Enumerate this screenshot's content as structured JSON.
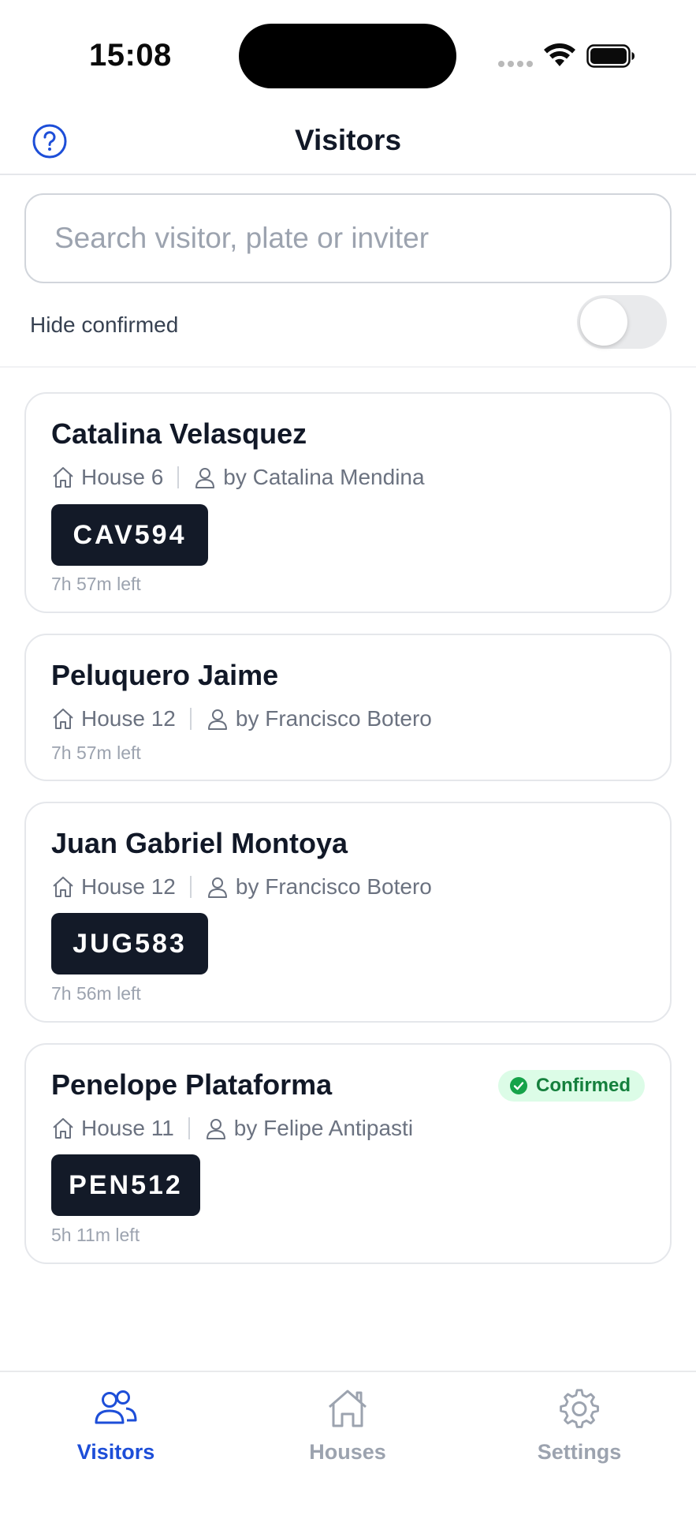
{
  "status_bar": {
    "time": "15:08"
  },
  "header": {
    "title": "Visitors"
  },
  "search": {
    "placeholder": "Search visitor, plate or inviter"
  },
  "filter": {
    "hide_confirmed_label": "Hide confirmed",
    "hide_confirmed_on": false
  },
  "visitors": [
    {
      "name": "Catalina Velasquez",
      "house": "House 6",
      "inviter": "by Catalina Mendina",
      "plate": "CAV594",
      "time_left": "7h 57m left"
    },
    {
      "name": "Peluquero Jaime",
      "house": "House 12",
      "inviter": "by Francisco Botero",
      "plate": "",
      "time_left": "7h 57m left"
    },
    {
      "name": "Juan Gabriel Montoya",
      "house": "House 12",
      "inviter": "by Francisco Botero",
      "plate": "JUG583",
      "time_left": "7h 56m left"
    },
    {
      "name": "Penelope Plataforma",
      "house": "House 11",
      "inviter": "by Felipe Antipasti",
      "plate": "PEN512",
      "time_left": "5h 11m left",
      "status": "Confirmed"
    }
  ],
  "tabs": [
    {
      "label": "Visitors",
      "icon": "users-icon",
      "active": true
    },
    {
      "label": "Houses",
      "icon": "home-icon",
      "active": false
    },
    {
      "label": "Settings",
      "icon": "gear-icon",
      "active": false
    }
  ],
  "colors": {
    "accent": "#1d4ed8",
    "inactive_tab": "#9ca3af",
    "plate_bg": "#131a28",
    "confirmed_bg": "#dcfce7",
    "confirmed_text": "#15803d"
  }
}
